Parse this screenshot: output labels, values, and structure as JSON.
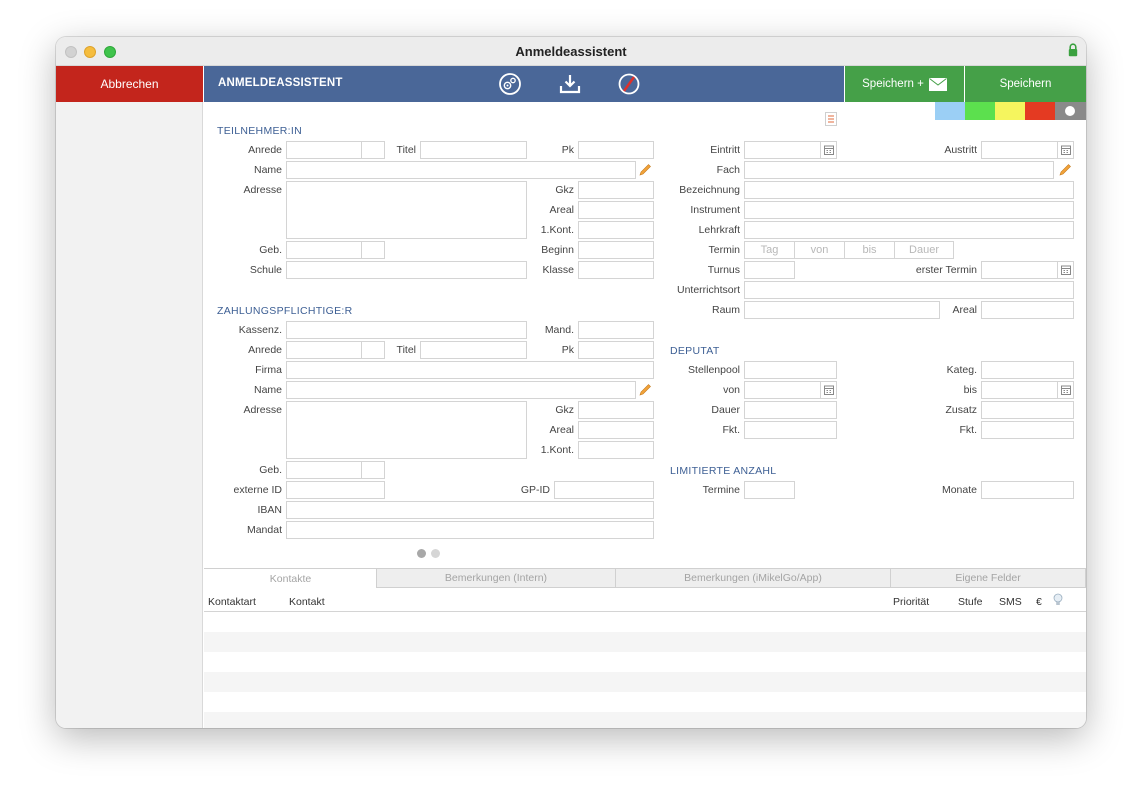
{
  "window": {
    "title": "Anmeldeassistent"
  },
  "toolbar": {
    "cancel_label": "Abbrechen",
    "title": "ANMELDEASSISTENT",
    "save_mail_label": "Speichern +",
    "save_label": "Speichern",
    "icons": [
      "settings-icon",
      "download-icon",
      "no-entry-icon",
      "mail-icon",
      "lock-icon"
    ]
  },
  "colors": {
    "cancel": "#c3251c",
    "toolbar_blue": "#4a6798",
    "save_green": "#45a048",
    "section_title": "#3d5f94",
    "strip": [
      "#9bcff5",
      "#5ce04e",
      "#f5f55e",
      "#e43a22",
      "#8a8a8a"
    ]
  },
  "participant": {
    "title": "TEILNEHMER:IN",
    "anrede": "Anrede",
    "titel": "Titel",
    "pk": "Pk",
    "name": "Name",
    "adresse": "Adresse",
    "gkz": "Gkz",
    "areal": "Areal",
    "kont": "1.Kont.",
    "geb": "Geb.",
    "beginn": "Beginn",
    "schule": "Schule",
    "klasse": "Klasse"
  },
  "payer": {
    "title": "ZAHLUNGSPFLICHTIGE:R",
    "kassenz": "Kassenz.",
    "mand": "Mand.",
    "anrede": "Anrede",
    "titel": "Titel",
    "pk": "Pk",
    "firma": "Firma",
    "name": "Name",
    "adresse": "Adresse",
    "gkz": "Gkz",
    "areal": "Areal",
    "kont": "1.Kont.",
    "geb": "Geb.",
    "externe_id": "externe ID",
    "gp_id": "GP-ID",
    "iban": "IBAN",
    "mandat": "Mandat"
  },
  "course": {
    "eintritt": "Eintritt",
    "austritt": "Austritt",
    "fach": "Fach",
    "bezeichnung": "Bezeichnung",
    "instrument": "Instrument",
    "lehrkraft": "Lehrkraft",
    "termin": "Termin",
    "termin_segments": [
      "Tag",
      "von",
      "bis",
      "Dauer"
    ],
    "turnus": "Turnus",
    "erster_termin": "erster Termin",
    "unterrichtsort": "Unterrichtsort",
    "raum": "Raum",
    "areal": "Areal"
  },
  "deputat": {
    "title": "DEPUTAT",
    "stellenpool": "Stellenpool",
    "kateg": "Kateg.",
    "von": "von",
    "bis": "bis",
    "dauer": "Dauer",
    "zusatz": "Zusatz",
    "fkt_left": "Fkt.",
    "fkt_right": "Fkt."
  },
  "limit": {
    "title": "LIMITIERTE ANZAHL",
    "termine": "Termine",
    "monate": "Monate"
  },
  "tabs": [
    {
      "label": "Kontakte",
      "active": true
    },
    {
      "label": "Bemerkungen (Intern)",
      "active": false
    },
    {
      "label": "Bemerkungen (iMikelGo/App)",
      "active": false
    },
    {
      "label": "Eigene Felder",
      "active": false
    }
  ],
  "grid": {
    "columns": [
      "Kontaktart",
      "Kontakt",
      "Priorität",
      "Stufe",
      "SMS",
      "€"
    ]
  }
}
